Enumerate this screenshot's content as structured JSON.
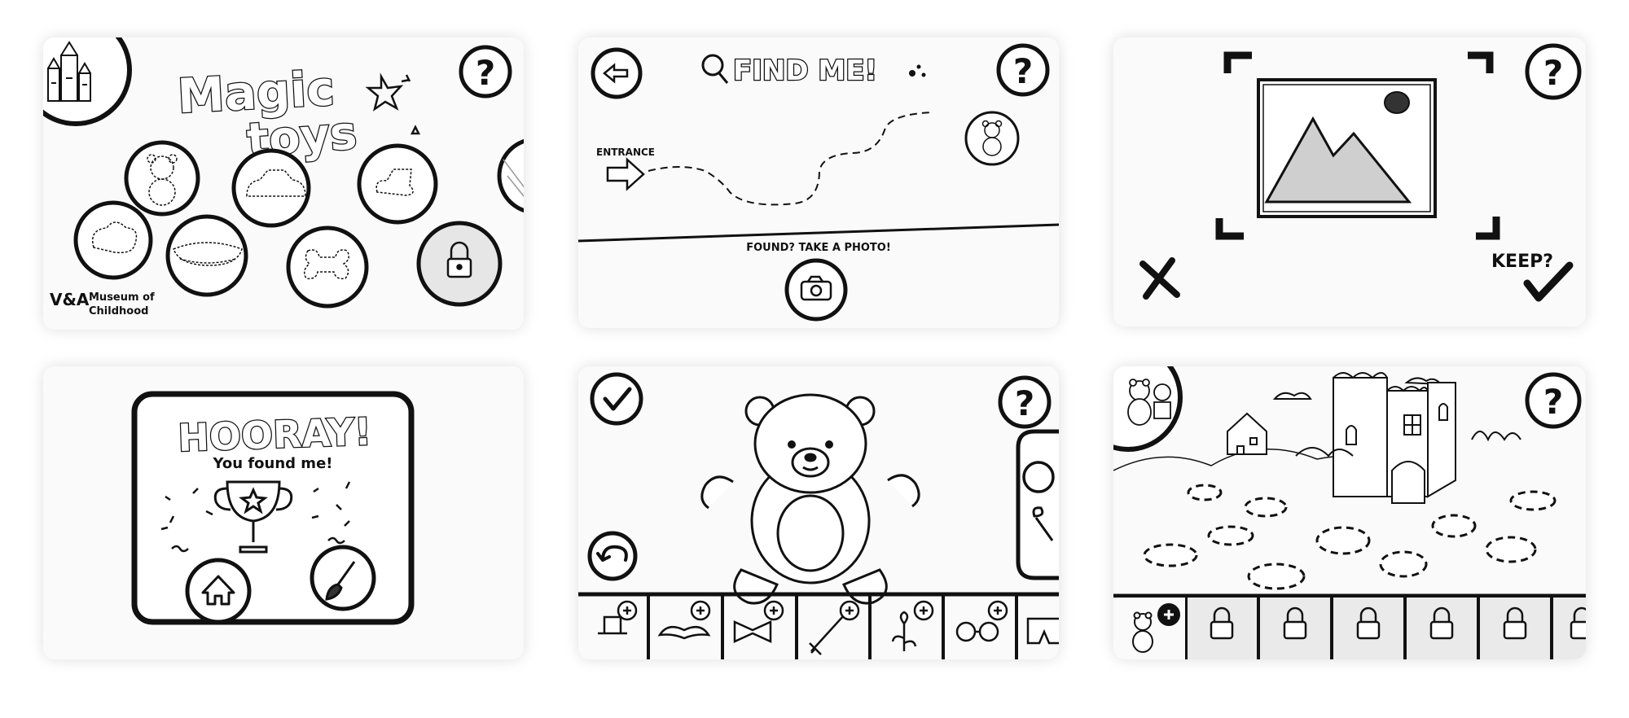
{
  "screen1": {
    "title_line1": "Magic",
    "title_line2": "toys",
    "brand_logo_text": "V&A",
    "brand_name_line1": "Museum of",
    "brand_name_line2": "Childhood",
    "help_glyph": "?"
  },
  "screen2": {
    "title": "FIND ME!",
    "entrance_label": "ENTRANCE",
    "prompt": "FOUND? TAKE A PHOTO!",
    "help_glyph": "?"
  },
  "screen3": {
    "keep_label": "KEEP?",
    "help_glyph": "?"
  },
  "screen4": {
    "title": "HOORAY!",
    "subtitle": "You found me!"
  },
  "screen5": {
    "help_glyph": "?",
    "tray_items": [
      "hat-icon",
      "moustache-icon",
      "bow-tie-icon",
      "sword-icon",
      "flower-icon",
      "glasses-icon",
      "shorts-icon"
    ]
  },
  "screen6": {
    "help_glyph": "?",
    "locked_slots": 6
  },
  "colors": {
    "ink": "#111111",
    "paper": "#fafafa",
    "shade": "#cfcfcf"
  }
}
